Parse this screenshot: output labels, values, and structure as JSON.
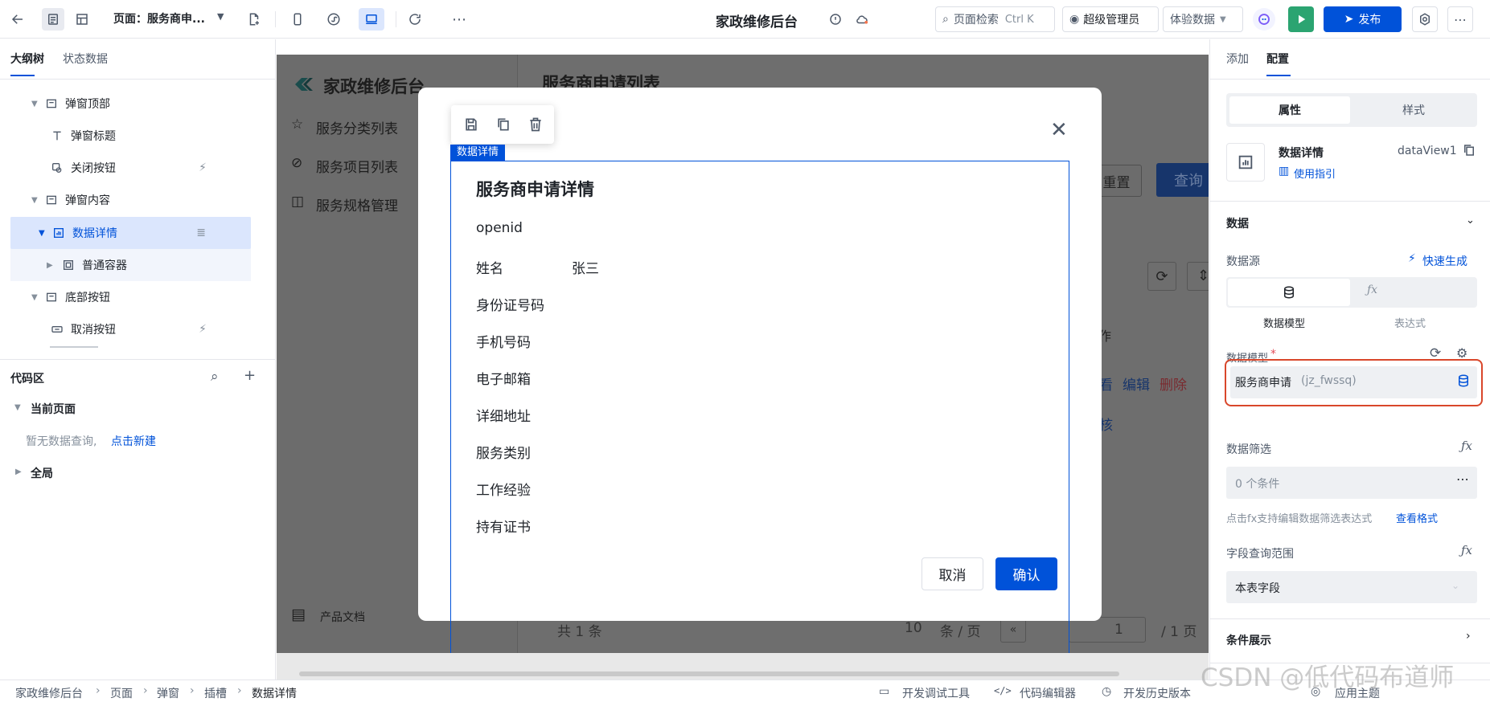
{
  "topbar": {
    "page_label": "页面：服务商申...",
    "app_title": "家政维修后台",
    "search_placeholder": "页面检索",
    "search_shortcut": "Ctrl K",
    "user": "超级管理员",
    "data_mode": "体验数据",
    "publish": "发布"
  },
  "left": {
    "tabs": [
      "大纲树",
      "状态数据"
    ],
    "tree": [
      {
        "label": "弹窗顶部",
        "icon": "container-icon"
      },
      {
        "label": "弹窗标题",
        "icon": "text-icon"
      },
      {
        "label": "关闭按钮",
        "icon": "button-icon"
      },
      {
        "label": "弹窗内容",
        "icon": "container-icon"
      },
      {
        "label": "数据详情",
        "icon": "chart-icon"
      },
      {
        "label": "普通容器",
        "icon": "box-icon"
      },
      {
        "label": "底部按钮",
        "icon": "container-icon"
      },
      {
        "label": "取消按钮",
        "icon": "button-icon"
      }
    ],
    "code_area": {
      "title": "代码区",
      "current_page": "当前页面",
      "empty_text": "暂无数据查询,",
      "create_link": "点击新建",
      "global": "全局"
    }
  },
  "canvas": {
    "logo_text": "家政维修后台",
    "menu": [
      "服务分类列表",
      "服务项目列表",
      "服务规格管理"
    ],
    "docs": "产品文档",
    "page_heading": "服务商申请列表",
    "reset": "重置",
    "query": "查询",
    "col_action": "作",
    "row_actions": [
      "看",
      "编辑",
      "删除"
    ],
    "row2_action": "核",
    "total_text": "共 1 条",
    "page_size": "10",
    "per_page": "条 / 页",
    "page_num": "1",
    "page_total": "/ 1 页"
  },
  "modal": {
    "badge": "数据详情",
    "title": "服务商申请详情",
    "fields": [
      {
        "label": "openid",
        "value": ""
      },
      {
        "label": "姓名",
        "value": "张三"
      },
      {
        "label": "身份证号码",
        "value": ""
      },
      {
        "label": "手机号码",
        "value": ""
      },
      {
        "label": "电子邮箱",
        "value": ""
      },
      {
        "label": "详细地址",
        "value": ""
      },
      {
        "label": "服务类别",
        "value": ""
      },
      {
        "label": "工作经验",
        "value": ""
      },
      {
        "label": "持有证书",
        "value": ""
      }
    ],
    "cancel": "取消",
    "confirm": "确认"
  },
  "right": {
    "tabs": [
      "添加",
      "配置"
    ],
    "seg": [
      "属性",
      "样式"
    ],
    "component_name": "数据详情",
    "component_id": "dataView1",
    "guide_link": "使用指引",
    "section_data": "数据",
    "datasource_label": "数据源",
    "quick_gen": "快速生成",
    "source_types": [
      "数据模型",
      "表达式"
    ],
    "model_label": "数据模型",
    "model_required": "*",
    "model_value": "服务商申请",
    "model_code": "(jz_fwssq)",
    "filter_label": "数据筛选",
    "filter_value": "0 个条件",
    "filter_hint": "点击fx支持编辑数据筛选表达式",
    "filter_hint_link": "查看格式",
    "field_range_label": "字段查询范围",
    "field_range_value": "本表字段",
    "condition_display": "条件展示"
  },
  "footer": {
    "breadcrumb": [
      "家政维修后台",
      "页面",
      "弹窗",
      "插槽",
      "数据详情"
    ],
    "tools": [
      "开发调试工具",
      "代码编辑器",
      "开发历史版本"
    ],
    "theme": "应用主题",
    "watermark": "CSDN @低代码布道师"
  },
  "colors": {
    "primary": "#0052d9",
    "accent_red": "#e34d59",
    "run_green": "#2ba471",
    "selected_bg": "#dbe6fd"
  }
}
